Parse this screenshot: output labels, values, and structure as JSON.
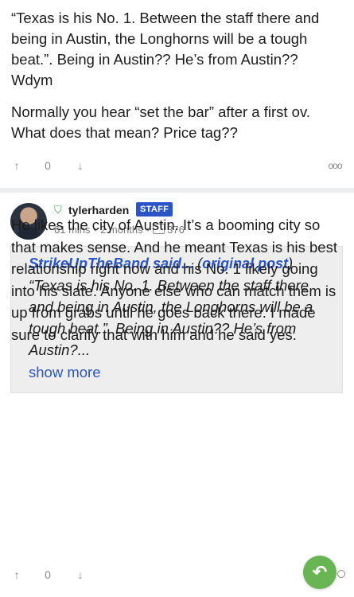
{
  "post1": {
    "paragraph1": "“Texas is his No. 1. Between the staff there and being in Austin, the Longhorns will be a tough beat.”. Being in Austin?? He’s from Austin?? Wdym",
    "paragraph2": "Normally you hear “set the bar” after a first ov. What does that mean? Price tag??",
    "vote_count": "0"
  },
  "post2": {
    "username": "tylerharden",
    "badge": "STAFF",
    "time_ago": "61 mins",
    "account_age": "2 months",
    "comment_count": "376",
    "quote": {
      "author_said": "StrikeUpTheBand said...",
      "paren_open": "(",
      "original_link": "original post",
      "paren_close": ")",
      "text": "“Texas is his No. 1. Between the staff there and being in Austin, the Longhorns will be a tough beat.”. Being in Austin?? He’s from Austin?...",
      "show_more": "show more"
    },
    "body": "He likes the city of Austin. It’s a booming city so that makes sense. And he meant Texas is his best relationship right now and his No. 1 likely going into his slate. Anyone else who can match them is up from grabs until he goes back there. I made sure to clarify that with him and he said yes.",
    "vote_count": "0"
  },
  "icons": {
    "upvote": "↑",
    "downvote": "↓",
    "more": "ooo",
    "shield": "⛉",
    "reply": "↶",
    "dot": "•"
  },
  "colors": {
    "accent": "#2b55c7",
    "staff_badge": "#2b55c7",
    "verified": "#3fa34d",
    "reply_fab": "#6ab553"
  }
}
